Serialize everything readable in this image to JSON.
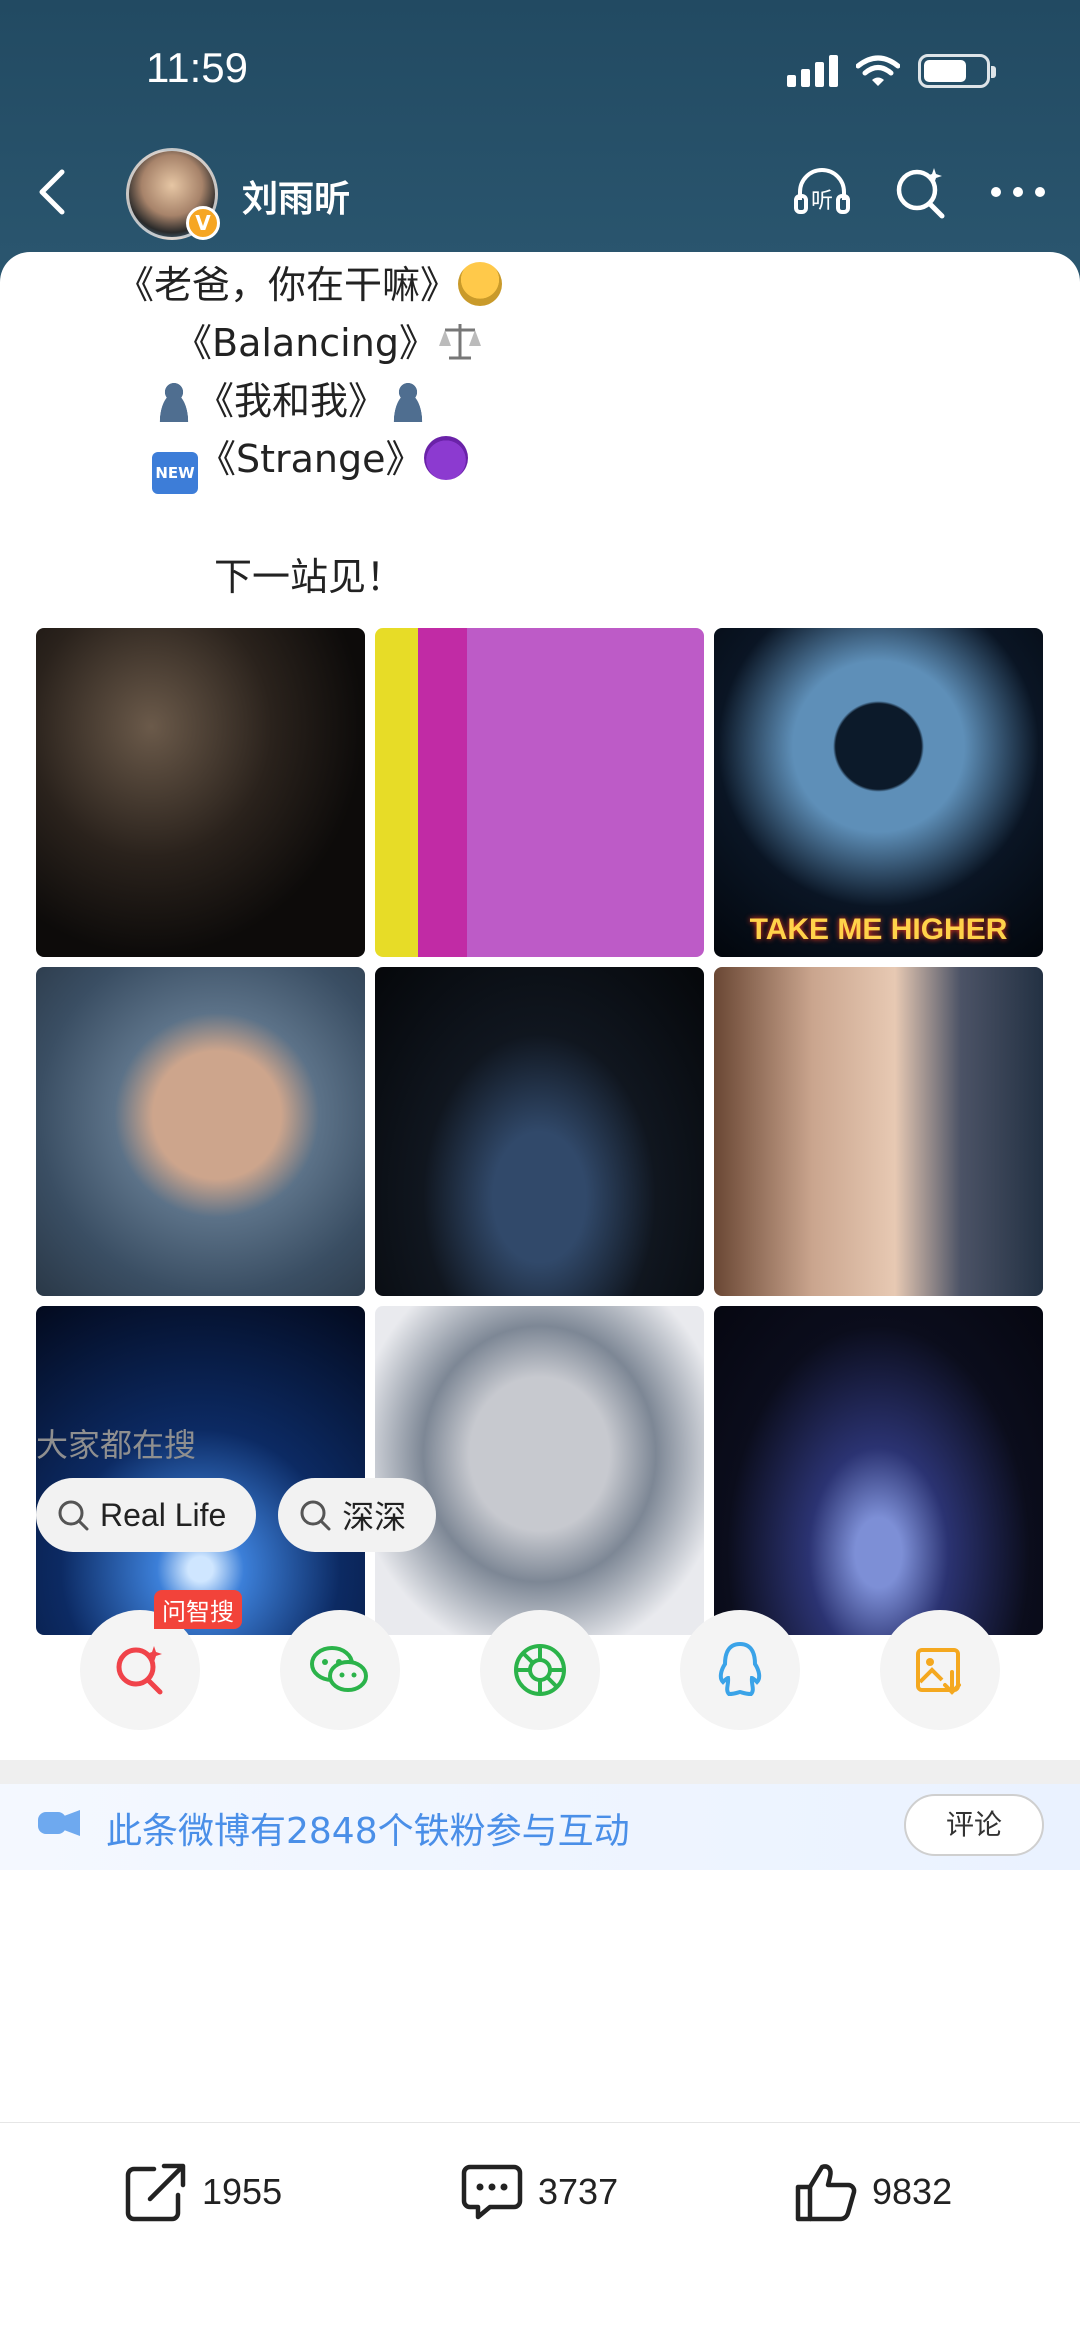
{
  "status_bar": {
    "time": "11:59",
    "battery_level": 0.7
  },
  "header": {
    "back_icon": "chevron-left-icon",
    "user_name": "刘雨昕",
    "verified_badge": "V",
    "icons": [
      "listen-icon",
      "sparkle-search-icon",
      "more-icon"
    ],
    "listen_label": "听"
  },
  "post": {
    "lines": [
      {
        "text": "《老爸，你在干嘛》",
        "emoji": "man-emoji"
      },
      {
        "text": "《Balancing》",
        "emoji": "scales-emoji"
      },
      {
        "text": "《我和我》",
        "emoji_before": "person-silhouette-emoji",
        "emoji": "person-silhouette-emoji"
      },
      {
        "text": "《Strange》",
        "emoji_before": "new-badge-emoji",
        "emoji": "smiling-devil-emoji",
        "badge_text": "NEW"
      },
      {
        "text": "下一站见！"
      }
    ]
  },
  "photos": [
    {
      "name": "photo-birthday-stage",
      "caption": ""
    },
    {
      "name": "photo-strange-poster",
      "caption": ""
    },
    {
      "name": "photo-take-me-higher",
      "caption": "TAKE ME HIGHER"
    },
    {
      "name": "photo-selfie-hand",
      "caption": ""
    },
    {
      "name": "photo-stadium",
      "caption": ""
    },
    {
      "name": "photo-two-friends",
      "caption": ""
    },
    {
      "name": "photo-blue-lights",
      "caption": ""
    },
    {
      "name": "photo-armor-costume",
      "caption": ""
    },
    {
      "name": "photo-spotlight-silhouette",
      "caption": ""
    }
  ],
  "trending": {
    "title": "大家都在搜",
    "chips": [
      "Real Life",
      "深深"
    ]
  },
  "share": {
    "badge": "问智搜",
    "buttons": [
      "ai-search-icon",
      "wechat-icon",
      "moments-icon",
      "qq-icon",
      "save-image-icon"
    ]
  },
  "fans": {
    "text": "此条微博有2848个铁粉参与互动",
    "comment_button": "评论"
  },
  "actions": {
    "repost_count": "1955",
    "comment_count": "3737",
    "like_count": "9832"
  },
  "colors": {
    "header_bg": "#224a62",
    "accent_blue": "#4a8fe8",
    "badge_red": "#f2433a"
  }
}
